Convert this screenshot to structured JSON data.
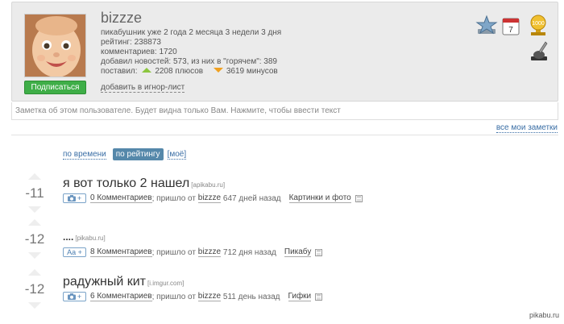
{
  "profile": {
    "username": "bizzze",
    "info": [
      "пикабушник уже 2 года 2 месяца 3 недели 3 дня",
      "рейтинг: 238873",
      "комментариев: 1720",
      "добавил новостей: 573, из них в \"горячем\": 389"
    ],
    "votes_prefix": "поставил:",
    "pluses": "2208 плюсов",
    "minuses": "3619 минусов",
    "subscribe_label": "Подписаться",
    "ignore_label": "добавить в игнор-лист",
    "award_badge_text": "1000"
  },
  "note_placeholder": "Заметка об этом пользователе. Будет видна только Вам. Нажмите, чтобы ввести текст",
  "all_notes_link": "все мои заметки",
  "sort": {
    "by_time": "по времени",
    "by_rating": "по рейтингу",
    "mine": "[моё]"
  },
  "posts": [
    {
      "score": "-11",
      "title": "я вот только 2 нашел",
      "source": "[apikabu.ru]",
      "tag": "+",
      "comments": "0 Комментариев",
      "from_text": "; пришло от",
      "author": "bizzze",
      "time": "647 дней назад",
      "category": "Картинки и фото"
    },
    {
      "score": "-12",
      "title": "....",
      "source": "[pikabu.ru]",
      "tag": "Aa +",
      "comments": "8 Комментариев",
      "from_text": "; пришло от",
      "author": "bizzze",
      "time": "712 дня назад",
      "category": "Пикабу"
    },
    {
      "score": "-12",
      "title": "радужный кит",
      "source": "[i.imgur.com]",
      "tag": "+",
      "comments": "6 Комментариев",
      "from_text": "; пришло от",
      "author": "bizzze",
      "time": "511 день назад",
      "category": "Гифки"
    }
  ],
  "watermark": "pikabu.ru",
  "colors": {
    "subscribe": "#3fae48",
    "link": "#3a6ea5",
    "active_sort": "#5588aa",
    "plus": "#8cc63f",
    "minus": "#f0a020"
  }
}
